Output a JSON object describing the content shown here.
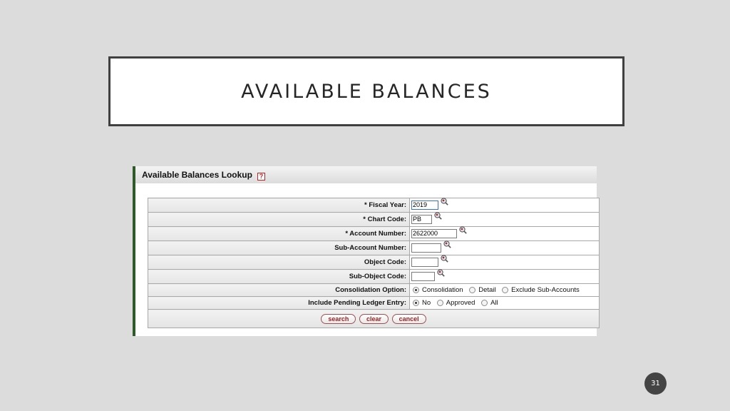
{
  "slide": {
    "title": "AVAILABLE BALANCES",
    "page_number": "31"
  },
  "lookup": {
    "header_title": "Available Balances Lookup",
    "help_icon": "help-question-icon",
    "fields": [
      {
        "label": "*  Fiscal Year:",
        "value": "2019"
      },
      {
        "label": "*  Chart Code:",
        "value": "PB"
      },
      {
        "label": "*  Account Number:",
        "value": "2622000"
      },
      {
        "label": "Sub-Account Number:",
        "value": ""
      },
      {
        "label": "Object Code:",
        "value": ""
      },
      {
        "label": "Sub-Object Code:",
        "value": ""
      }
    ],
    "consolidation": {
      "label": "Consolidation Option:",
      "options": [
        "Consolidation",
        "Detail",
        "Exclude Sub-Accounts"
      ],
      "selected": "Consolidation"
    },
    "pending": {
      "label": "Include Pending Ledger Entry:",
      "options": [
        "No",
        "Approved",
        "All"
      ],
      "selected": "No"
    },
    "buttons": {
      "search": "search",
      "clear": "clear",
      "cancel": "cancel"
    }
  },
  "colors": {
    "slide_bg": "#dcdcdc",
    "left_bar": "#2f5a2c",
    "button_text": "#9a1f1f",
    "page_badge": "#444444"
  }
}
